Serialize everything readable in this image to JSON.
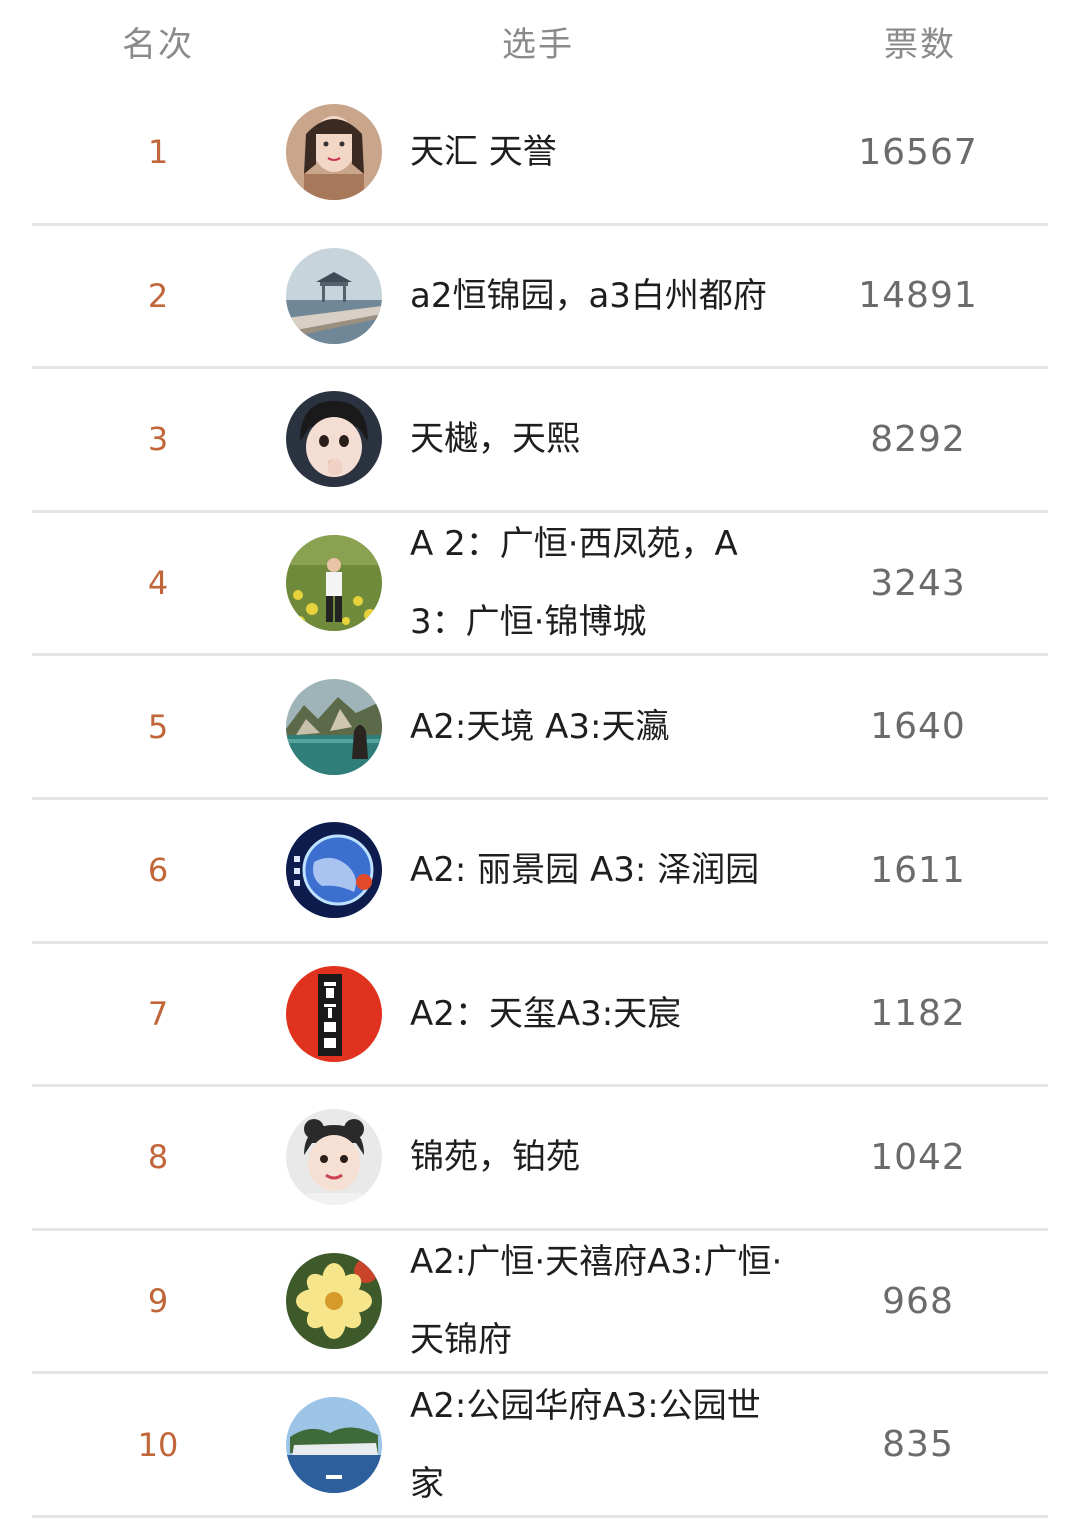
{
  "header": {
    "rank_label": "名次",
    "player_label": "选手",
    "votes_label": "票数"
  },
  "colors": {
    "rank": "#c0663a",
    "votes": "#6b6b6b",
    "divider": "#e5e5e5"
  },
  "rows": [
    {
      "rank": "1",
      "name": "天汇 天誉",
      "votes": "16567",
      "avatar": "portrait-woman-icon"
    },
    {
      "rank": "2",
      "name": "a2恒锦园，a3白州都府",
      "votes": "14891",
      "avatar": "lake-pier-icon"
    },
    {
      "rank": "3",
      "name": "天樾，天熙",
      "votes": "8292",
      "avatar": "child-portrait-icon"
    },
    {
      "rank": "4",
      "name": "A 2：广恒·西凤苑，A 3：广恒·锦博城",
      "votes": "3243",
      "avatar": "man-in-field-icon"
    },
    {
      "rank": "5",
      "name": "A2:天境 A3:天瀛",
      "votes": "1640",
      "avatar": "mountain-lake-icon"
    },
    {
      "rank": "6",
      "name": "A2: 丽景园 A3: 泽润园",
      "votes": "1611",
      "avatar": "planet-icon"
    },
    {
      "rank": "7",
      "name": "A2：天玺A3:天宸",
      "votes": "1182",
      "avatar": "red-seal-icon"
    },
    {
      "rank": "8",
      "name": "锦苑，铂苑",
      "votes": "1042",
      "avatar": "girl-portrait-icon"
    },
    {
      "rank": "9",
      "name": "A2:广恒·天禧府A3:广恒·天锦府",
      "votes": "968",
      "avatar": "yellow-flower-icon"
    },
    {
      "rank": "10",
      "name": "A2:公园华府A3:公园世家",
      "votes": "835",
      "avatar": "island-sea-icon"
    }
  ]
}
